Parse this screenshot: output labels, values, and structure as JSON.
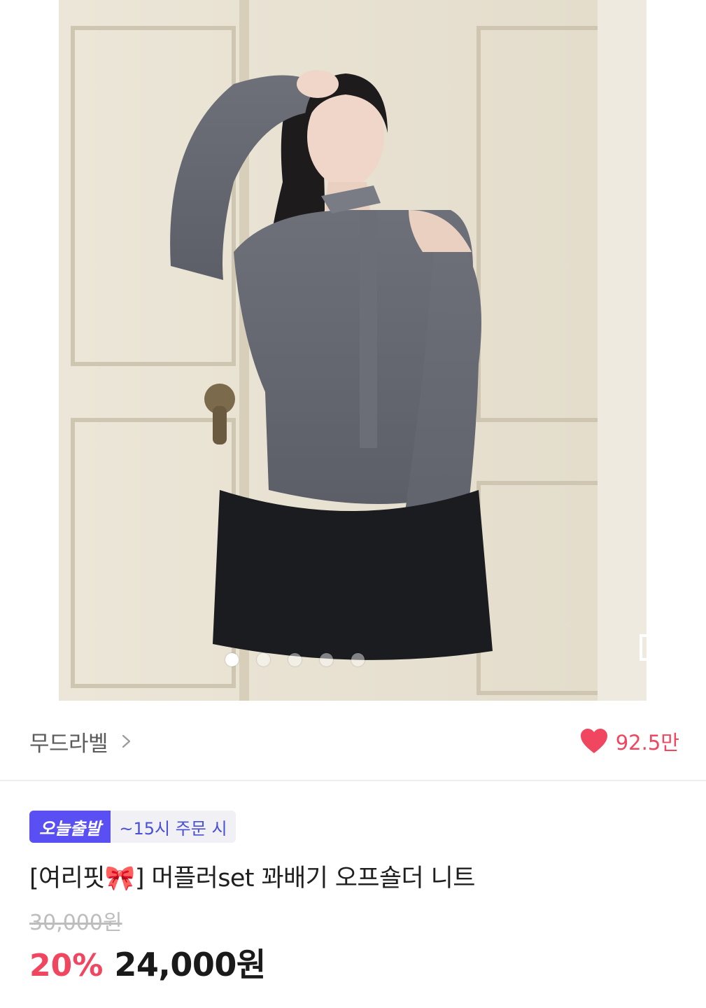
{
  "product": {
    "shop_name": "무드라벨",
    "likes": "92.5만",
    "badge_main": "오늘출발",
    "badge_sub": "~15시 주문 시",
    "title": "[여리핏🎀] 머플러set 꽈배기 오프숄더 니트",
    "original_price": "30,000원",
    "discount": "20%",
    "price": "24,000원"
  },
  "carousel": {
    "total_images": 5,
    "active_index": 0
  },
  "colors": {
    "accent_red": "#f1465f",
    "badge_purple": "#5a4ff2"
  },
  "icons": {
    "shop_arrow": "chevron-right-icon",
    "like": "heart-icon",
    "expand": "expand-icon"
  }
}
